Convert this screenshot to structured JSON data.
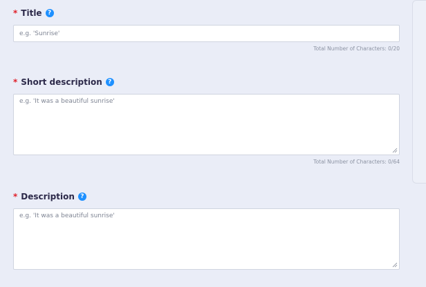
{
  "form": {
    "title": {
      "required_mark": "*",
      "label": "Title",
      "help_icon": "question-circle-icon",
      "placeholder": "e.g. 'Sunrise'",
      "char_count": "Total Number of Characters: 0/20"
    },
    "short_description": {
      "required_mark": "*",
      "label": "Short description",
      "help_icon": "question-circle-icon",
      "placeholder": "e.g. 'It was a beautiful sunrise'",
      "char_count": "Total Number of Characters: 0/64"
    },
    "description": {
      "required_mark": "*",
      "label": "Description",
      "help_icon": "question-circle-icon",
      "placeholder": "e.g. 'It was a beautiful sunrise'"
    }
  },
  "colors": {
    "required": "#e0202a",
    "help_icon": "#1e90ff",
    "label_text": "#2d2a4a",
    "background": "#eaedf7"
  }
}
